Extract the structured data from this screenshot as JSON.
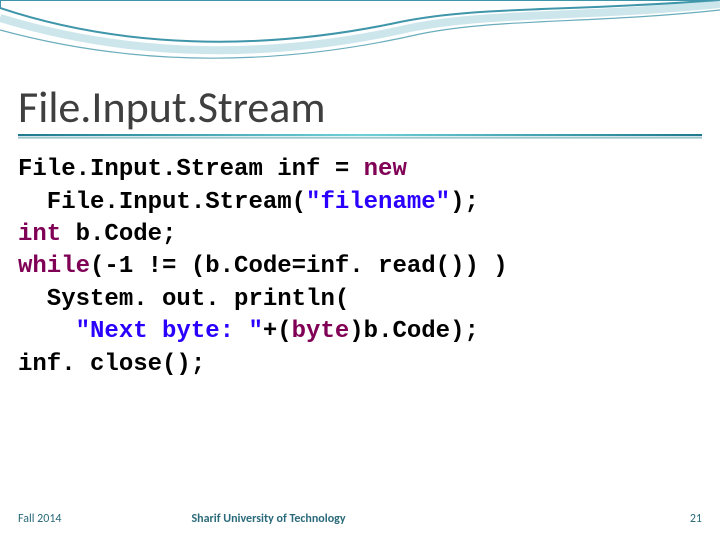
{
  "title": "File.Input.Stream",
  "code": {
    "l1a": "File.Input.Stream inf = ",
    "l1b": "new",
    "l2a": "  File.Input.Stream(",
    "l2b": "\"filename\"",
    "l2c": ");",
    "l3a": "int",
    "l3b": " b.Code;",
    "l4a": "while",
    "l4b": "(-1 != (b.Code=inf. read()) )",
    "l5": "  System. out. println(",
    "l6a": "    ",
    "l6b": "\"Next byte: \"",
    "l6c": "+(",
    "l6d": "byte",
    "l6e": ")b.Code);",
    "l7": "inf. close();"
  },
  "footer": {
    "left": "Fall 2014",
    "center": "Sharif University of Technology",
    "right": "21"
  },
  "colors": {
    "keyword": "#7f0055",
    "string": "#2a00ff",
    "title": "#3f3f3f",
    "accent": "#2a6a7a"
  }
}
